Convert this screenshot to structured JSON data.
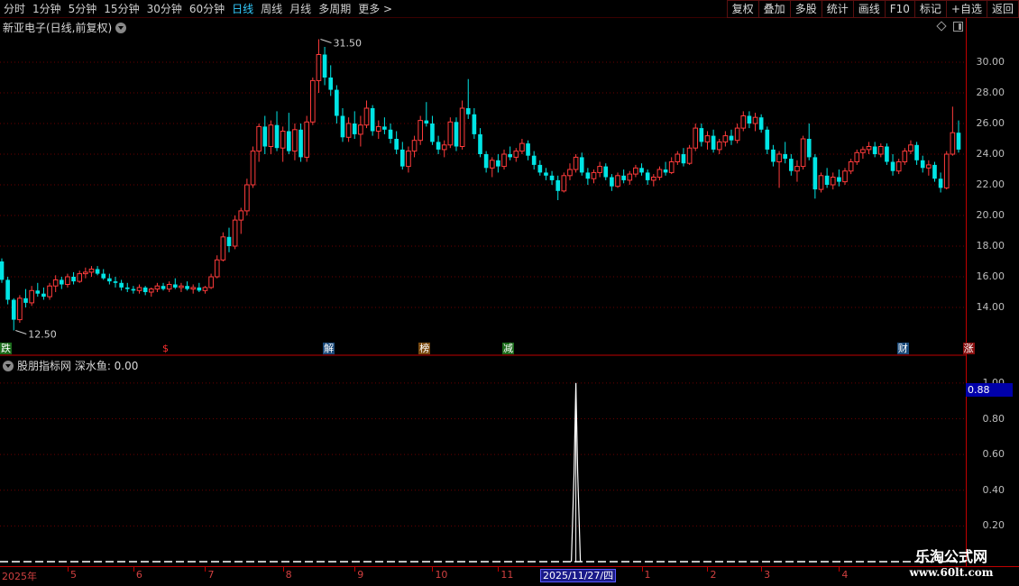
{
  "toolbar": {
    "periods": [
      {
        "label": "分时",
        "active": false
      },
      {
        "label": "1分钟",
        "active": false
      },
      {
        "label": "5分钟",
        "active": false
      },
      {
        "label": "15分钟",
        "active": false
      },
      {
        "label": "30分钟",
        "active": false
      },
      {
        "label": "60分钟",
        "active": false
      },
      {
        "label": "日线",
        "active": true
      },
      {
        "label": "周线",
        "active": false
      },
      {
        "label": "月线",
        "active": false
      },
      {
        "label": "多周期",
        "active": false
      },
      {
        "label": "更多 >",
        "active": false
      }
    ],
    "buttons": [
      "复权",
      "叠加",
      "多股",
      "统计",
      "画线",
      "F10",
      "标记",
      "+自选",
      "返回"
    ]
  },
  "main_title": "新亚电子(日线,前复权)",
  "indicator_title": "股朋指标网  深水鱼: 0.00",
  "price_axis": [
    "30.00",
    "28.00",
    "26.00",
    "24.00",
    "22.00",
    "20.00",
    "18.00",
    "16.00",
    "14.00"
  ],
  "indicator_axis": [
    "1.00",
    "0.80",
    "0.60",
    "0.40",
    "0.20"
  ],
  "indicator_value_box": "0.88",
  "high_marker": "31.50",
  "low_marker": "12.50",
  "events": [
    {
      "text": "跌",
      "color": "#ffffff",
      "bg": "#1a6a1a"
    },
    {
      "text": "$",
      "color": "#ff3030",
      "bg": "transparent"
    },
    {
      "text": "解",
      "color": "#ffffff",
      "bg": "#1a4a7a"
    },
    {
      "text": "榜",
      "color": "#ffffff",
      "bg": "#7a4a10"
    },
    {
      "text": "减",
      "color": "#ffffff",
      "bg": "#1a6a1a"
    },
    {
      "text": "财",
      "color": "#ffffff",
      "bg": "#1a4a7a"
    },
    {
      "text": "涨",
      "color": "#ffffff",
      "bg": "#8a1010"
    }
  ],
  "date_axis": {
    "year_label": "2025年",
    "months": [
      "5",
      "6",
      "7",
      "8",
      "9",
      "10",
      "11",
      "1",
      "2",
      "3",
      "4"
    ],
    "cursor": "2025/11/27/四"
  },
  "watermark": {
    "title": "乐淘公式网",
    "url": "www.60lt.com"
  },
  "colors": {
    "up": "#ff3b3b",
    "down": "#00e5e5",
    "grid": "#6a0000",
    "axis": "#c00000",
    "indicator": "#ffffff"
  },
  "chart_data": {
    "type": "candlestick",
    "ylim": [
      12,
      32
    ],
    "candles": [
      [
        17.0,
        17.2,
        15.6,
        15.8
      ],
      [
        15.8,
        16.0,
        14.2,
        14.5
      ],
      [
        14.5,
        14.6,
        12.5,
        13.2
      ],
      [
        13.2,
        14.8,
        13.0,
        14.6
      ],
      [
        14.6,
        15.2,
        14.0,
        14.3
      ],
      [
        14.3,
        15.4,
        14.1,
        15.1
      ],
      [
        15.1,
        15.6,
        14.7,
        14.9
      ],
      [
        14.9,
        15.3,
        14.5,
        14.7
      ],
      [
        14.7,
        15.6,
        14.5,
        15.4
      ],
      [
        15.4,
        16.1,
        15.0,
        15.8
      ],
      [
        15.8,
        16.0,
        15.2,
        15.5
      ],
      [
        15.5,
        16.2,
        15.3,
        16.0
      ],
      [
        16.0,
        16.3,
        15.5,
        15.7
      ],
      [
        15.7,
        16.4,
        15.6,
        16.2
      ],
      [
        16.2,
        16.6,
        15.9,
        16.3
      ],
      [
        16.3,
        16.7,
        16.0,
        16.5
      ],
      [
        16.5,
        16.7,
        16.1,
        16.2
      ],
      [
        16.2,
        16.5,
        15.8,
        15.9
      ],
      [
        15.9,
        16.2,
        15.5,
        15.7
      ],
      [
        15.7,
        16.0,
        15.3,
        15.6
      ],
      [
        15.6,
        15.8,
        15.1,
        15.3
      ],
      [
        15.3,
        15.6,
        15.0,
        15.2
      ],
      [
        15.2,
        15.4,
        14.9,
        15.1
      ],
      [
        15.1,
        15.5,
        14.9,
        15.3
      ],
      [
        15.3,
        15.4,
        14.8,
        15.0
      ],
      [
        15.0,
        15.3,
        14.7,
        15.2
      ],
      [
        15.2,
        15.6,
        15.0,
        15.4
      ],
      [
        15.4,
        15.6,
        15.1,
        15.2
      ],
      [
        15.2,
        15.7,
        15.0,
        15.5
      ],
      [
        15.5,
        15.9,
        15.2,
        15.3
      ],
      [
        15.3,
        15.6,
        15.0,
        15.4
      ],
      [
        15.4,
        15.7,
        15.1,
        15.2
      ],
      [
        15.2,
        15.5,
        14.9,
        15.3
      ],
      [
        15.3,
        15.6,
        15.0,
        15.1
      ],
      [
        15.1,
        15.4,
        14.9,
        15.3
      ],
      [
        15.3,
        16.2,
        15.2,
        16.0
      ],
      [
        16.0,
        17.4,
        15.9,
        17.1
      ],
      [
        17.1,
        18.9,
        17.0,
        18.6
      ],
      [
        18.6,
        19.2,
        17.6,
        18.0
      ],
      [
        18.0,
        20.0,
        17.8,
        19.7
      ],
      [
        19.7,
        20.5,
        18.8,
        20.3
      ],
      [
        20.3,
        22.4,
        20.0,
        22.0
      ],
      [
        22.0,
        24.5,
        21.8,
        24.2
      ],
      [
        24.2,
        26.0,
        23.5,
        25.8
      ],
      [
        25.8,
        26.5,
        24.0,
        24.5
      ],
      [
        24.5,
        26.2,
        24.0,
        25.9
      ],
      [
        25.9,
        26.8,
        24.2,
        24.4
      ],
      [
        24.4,
        25.8,
        23.5,
        25.5
      ],
      [
        25.5,
        26.7,
        24.0,
        24.2
      ],
      [
        24.2,
        26.0,
        23.6,
        25.6
      ],
      [
        25.6,
        26.0,
        23.5,
        23.8
      ],
      [
        23.8,
        26.5,
        23.5,
        26.1
      ],
      [
        26.1,
        29.0,
        25.9,
        28.8
      ],
      [
        28.8,
        31.5,
        28.0,
        30.5
      ],
      [
        30.5,
        31.0,
        28.5,
        29.0
      ],
      [
        29.0,
        29.8,
        27.8,
        28.2
      ],
      [
        28.2,
        28.5,
        26.0,
        26.5
      ],
      [
        26.5,
        27.0,
        24.8,
        25.1
      ],
      [
        25.1,
        26.4,
        24.8,
        26.0
      ],
      [
        26.0,
        26.8,
        25.0,
        25.3
      ],
      [
        25.3,
        26.5,
        24.5,
        25.9
      ],
      [
        25.9,
        27.5,
        25.7,
        27.0
      ],
      [
        27.0,
        27.2,
        25.2,
        25.5
      ],
      [
        25.5,
        26.2,
        25.0,
        25.8
      ],
      [
        25.8,
        26.4,
        25.3,
        25.6
      ],
      [
        25.6,
        26.0,
        24.7,
        25.0
      ],
      [
        25.0,
        25.5,
        24.0,
        24.3
      ],
      [
        24.3,
        24.8,
        23.0,
        23.2
      ],
      [
        23.2,
        24.5,
        22.8,
        24.2
      ],
      [
        24.2,
        25.2,
        23.8,
        24.9
      ],
      [
        24.9,
        26.5,
        24.6,
        26.2
      ],
      [
        26.2,
        27.4,
        25.8,
        26.0
      ],
      [
        26.0,
        26.5,
        24.6,
        24.8
      ],
      [
        24.8,
        25.2,
        24.0,
        24.3
      ],
      [
        24.3,
        24.9,
        23.8,
        24.6
      ],
      [
        24.6,
        26.4,
        24.4,
        26.1
      ],
      [
        26.1,
        26.4,
        24.2,
        24.5
      ],
      [
        24.5,
        27.5,
        24.3,
        27.0
      ],
      [
        27.0,
        28.9,
        26.3,
        26.6
      ],
      [
        26.6,
        27.0,
        25.0,
        25.3
      ],
      [
        25.3,
        25.7,
        23.8,
        24.0
      ],
      [
        24.0,
        24.2,
        22.8,
        23.1
      ],
      [
        23.1,
        23.8,
        22.5,
        23.6
      ],
      [
        23.6,
        24.0,
        22.8,
        23.2
      ],
      [
        23.2,
        24.3,
        23.0,
        24.0
      ],
      [
        24.0,
        24.5,
        23.6,
        23.8
      ],
      [
        23.8,
        24.4,
        23.5,
        24.2
      ],
      [
        24.2,
        25.0,
        24.0,
        24.7
      ],
      [
        24.7,
        24.9,
        23.6,
        23.9
      ],
      [
        23.9,
        24.2,
        23.0,
        23.3
      ],
      [
        23.3,
        23.6,
        22.6,
        22.8
      ],
      [
        22.8,
        23.1,
        22.3,
        22.6
      ],
      [
        22.6,
        22.9,
        22.0,
        22.3
      ],
      [
        22.3,
        22.6,
        21.0,
        21.6
      ],
      [
        21.6,
        22.8,
        21.5,
        22.6
      ],
      [
        22.6,
        23.4,
        22.3,
        23.0
      ],
      [
        23.0,
        24.0,
        22.8,
        23.8
      ],
      [
        23.8,
        24.1,
        22.6,
        22.8
      ],
      [
        22.8,
        23.1,
        22.0,
        22.4
      ],
      [
        22.4,
        23.0,
        22.1,
        22.8
      ],
      [
        22.8,
        23.5,
        22.5,
        23.2
      ],
      [
        23.2,
        23.4,
        22.3,
        22.5
      ],
      [
        22.5,
        22.7,
        21.6,
        21.9
      ],
      [
        21.9,
        22.8,
        21.8,
        22.6
      ],
      [
        22.6,
        23.0,
        22.1,
        22.3
      ],
      [
        22.3,
        22.9,
        22.0,
        22.7
      ],
      [
        22.7,
        23.3,
        22.5,
        23.1
      ],
      [
        23.1,
        23.4,
        22.6,
        22.8
      ],
      [
        22.8,
        23.0,
        22.0,
        22.3
      ],
      [
        22.3,
        22.7,
        21.9,
        22.5
      ],
      [
        22.5,
        23.2,
        22.3,
        23.0
      ],
      [
        23.0,
        23.5,
        22.6,
        22.8
      ],
      [
        22.8,
        23.8,
        22.7,
        23.5
      ],
      [
        23.5,
        24.2,
        23.3,
        24.0
      ],
      [
        24.0,
        24.4,
        23.2,
        23.4
      ],
      [
        23.4,
        24.6,
        23.3,
        24.4
      ],
      [
        24.4,
        26.0,
        24.2,
        25.7
      ],
      [
        25.7,
        26.0,
        24.5,
        24.8
      ],
      [
        24.8,
        25.5,
        24.3,
        25.2
      ],
      [
        25.2,
        25.6,
        24.1,
        24.3
      ],
      [
        24.3,
        25.0,
        24.0,
        24.8
      ],
      [
        24.8,
        25.5,
        24.5,
        25.2
      ],
      [
        25.2,
        25.6,
        24.6,
        24.9
      ],
      [
        24.9,
        26.0,
        24.7,
        25.7
      ],
      [
        25.7,
        26.8,
        25.5,
        26.5
      ],
      [
        26.5,
        26.8,
        25.7,
        26.0
      ],
      [
        26.0,
        26.7,
        25.5,
        26.4
      ],
      [
        26.4,
        26.6,
        25.4,
        25.6
      ],
      [
        25.6,
        25.8,
        24.0,
        24.3
      ],
      [
        24.3,
        24.6,
        23.2,
        23.5
      ],
      [
        23.5,
        24.2,
        21.8,
        24.0
      ],
      [
        24.0,
        24.8,
        23.4,
        23.7
      ],
      [
        23.7,
        24.0,
        22.6,
        22.9
      ],
      [
        22.9,
        23.6,
        22.2,
        23.2
      ],
      [
        23.2,
        25.2,
        23.0,
        25.0
      ],
      [
        25.0,
        26.0,
        23.6,
        23.8
      ],
      [
        23.8,
        24.0,
        21.1,
        21.7
      ],
      [
        21.7,
        22.8,
        21.5,
        22.6
      ],
      [
        22.6,
        23.1,
        21.8,
        22.0
      ],
      [
        22.0,
        22.8,
        21.7,
        22.5
      ],
      [
        22.5,
        23.0,
        21.9,
        22.2
      ],
      [
        22.2,
        23.1,
        22.0,
        22.9
      ],
      [
        22.9,
        23.7,
        22.7,
        23.5
      ],
      [
        23.5,
        24.3,
        23.3,
        24.1
      ],
      [
        24.1,
        24.5,
        23.7,
        24.3
      ],
      [
        24.3,
        24.8,
        24.0,
        24.5
      ],
      [
        24.5,
        24.8,
        23.8,
        24.0
      ],
      [
        24.0,
        24.7,
        23.8,
        24.5
      ],
      [
        24.5,
        24.7,
        23.3,
        23.5
      ],
      [
        23.5,
        24.0,
        22.6,
        22.9
      ],
      [
        22.9,
        23.7,
        22.7,
        23.5
      ],
      [
        23.5,
        24.4,
        23.3,
        24.2
      ],
      [
        24.2,
        24.9,
        24.0,
        24.6
      ],
      [
        24.6,
        24.8,
        23.3,
        23.6
      ],
      [
        23.6,
        23.9,
        22.8,
        23.1
      ],
      [
        23.1,
        23.6,
        22.6,
        23.3
      ],
      [
        23.3,
        23.5,
        22.2,
        22.4
      ],
      [
        22.4,
        22.8,
        21.5,
        21.8
      ],
      [
        21.8,
        24.2,
        21.7,
        24.0
      ],
      [
        24.0,
        27.1,
        23.9,
        25.4
      ],
      [
        25.4,
        26.2,
        24.1,
        24.3
      ]
    ],
    "indicator": {
      "name": "深水鱼",
      "ylim": [
        0,
        1.05
      ],
      "spike_index": 96,
      "spike_value": 1.0
    }
  }
}
